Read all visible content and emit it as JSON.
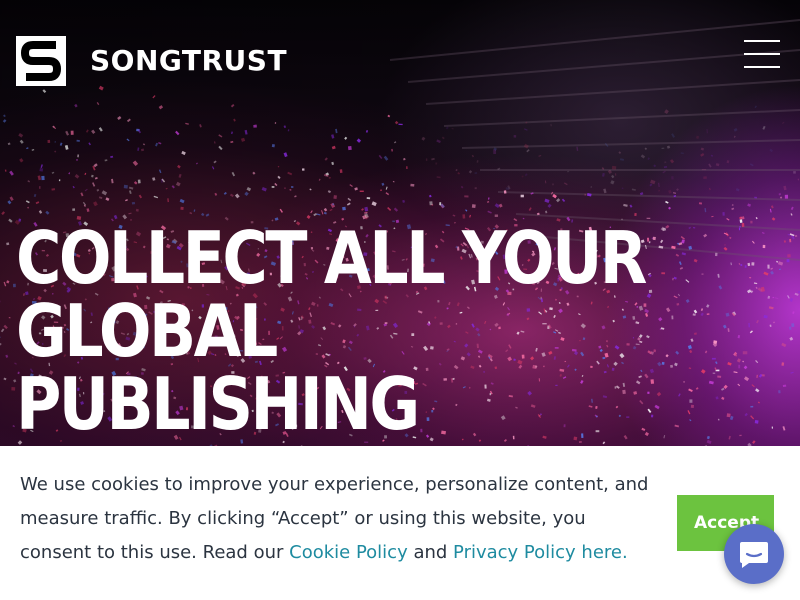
{
  "brand": {
    "name": "SONGTRUST",
    "logo_icon": "songtrust-s-logo-icon"
  },
  "header": {
    "menu_icon": "hamburger-menu-icon"
  },
  "hero": {
    "headline": "COLLECT ALL YOUR GLOBAL PUBLISHING ROYALTIES"
  },
  "cookie_banner": {
    "text_before": "We use cookies to improve your experience, personalize content, and measure traffic. By clicking “Accept” or using this website, you consent to this use. Read our ",
    "cookie_policy_link": "Cookie Policy",
    "text_between": " and ",
    "privacy_policy_link": "Privacy Policy here.",
    "accept_label": "Accept"
  },
  "chat": {
    "icon": "chat-bubble-icon"
  },
  "colors": {
    "accept_green": "#6cc33f",
    "link_teal": "#1e8ba0",
    "chat_blue": "#5a6ec8",
    "body_text": "#2b3440"
  }
}
